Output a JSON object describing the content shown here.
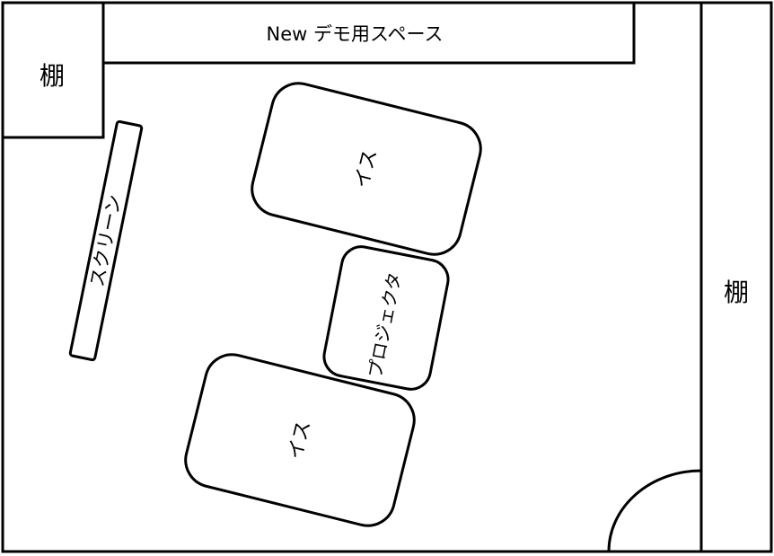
{
  "labels": {
    "demo_space": "New デモ用スペース",
    "shelf_left": "棚",
    "shelf_right": "棚",
    "screen": "スクリーン",
    "chair_top": "イス",
    "chair_bottom": "イス",
    "projector": "プロジェクタ"
  },
  "colors": {
    "stroke": "#000000",
    "fill": "#ffffff"
  }
}
